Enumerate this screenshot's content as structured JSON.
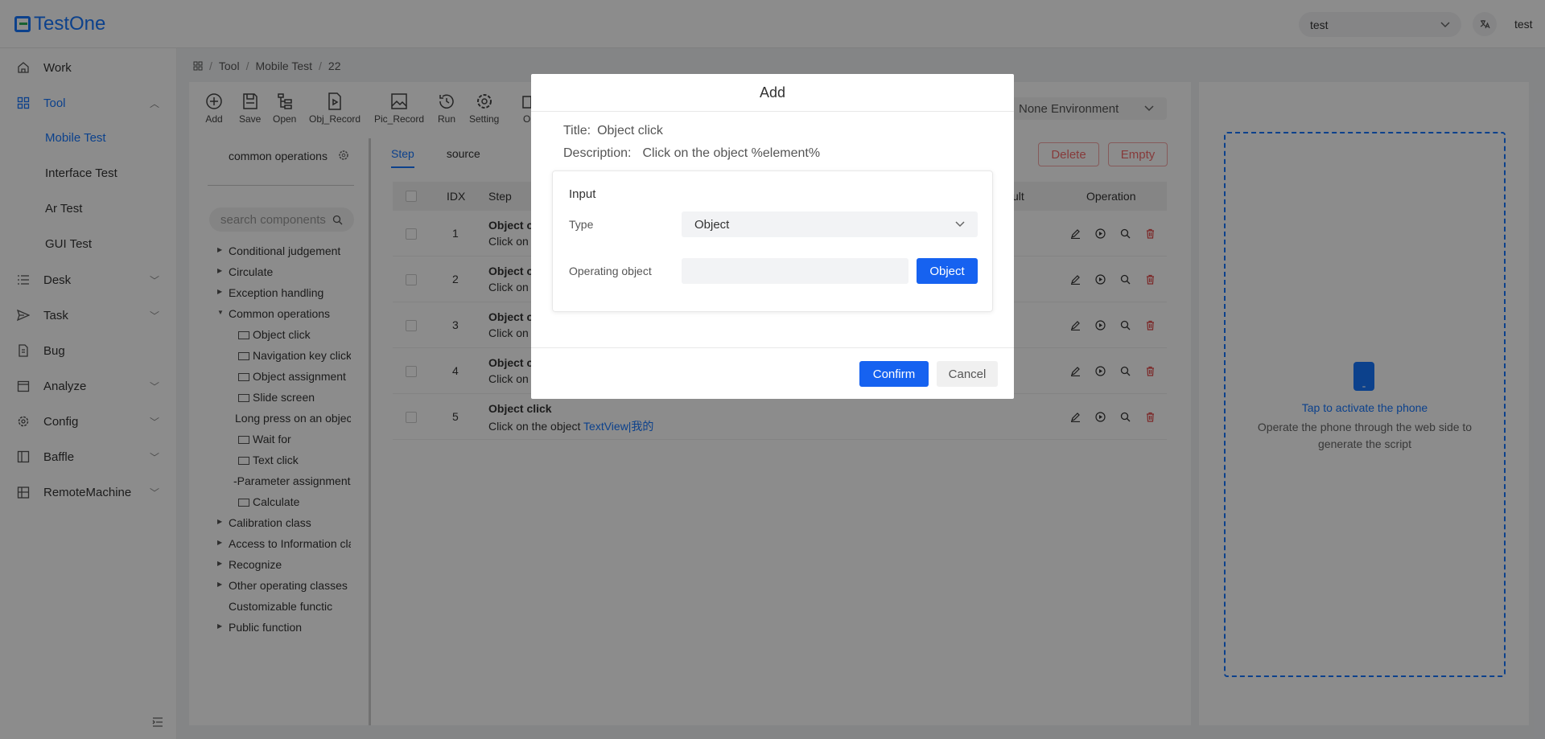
{
  "app": {
    "name": "TestOne"
  },
  "header": {
    "project": "test",
    "user": "test"
  },
  "sidebar": {
    "items": [
      {
        "label": "Work",
        "icon": "home-icon"
      },
      {
        "label": "Tool",
        "icon": "grid-icon"
      },
      {
        "label": "Desk",
        "icon": "list-icon"
      },
      {
        "label": "Task",
        "icon": "send-icon"
      },
      {
        "label": "Bug",
        "icon": "file-icon"
      },
      {
        "label": "Analyze",
        "icon": "calendar-icon"
      },
      {
        "label": "Config",
        "icon": "gear-icon"
      },
      {
        "label": "Baffle",
        "icon": "panel-icon"
      },
      {
        "label": "RemoteMachine",
        "icon": "machine-icon"
      }
    ],
    "tool_sub": [
      "Mobile Test",
      "Interface Test",
      "Ar Test",
      "GUI Test"
    ]
  },
  "breadcrumb": [
    "Tool",
    "Mobile Test",
    "22"
  ],
  "toolbar": {
    "buttons": [
      "Add",
      "Save",
      "Open",
      "Obj_Record",
      "Pic_Record",
      "Run",
      "Setting",
      "Ob"
    ]
  },
  "environment": {
    "value": "None Environment"
  },
  "components": {
    "title": "common operations",
    "search_placeholder": "search components",
    "tree": [
      "Conditional judgement",
      "Circulate",
      "Exception handling",
      "Common operations",
      "Object click",
      "Navigation key click",
      "Object assignment",
      "Slide screen",
      "Long press on an objec",
      "Wait for",
      "Text click",
      "-Parameter assignment",
      "Calculate",
      "Calibration class",
      "Access to Information cla",
      "Recognize",
      "Other operating classes",
      "Customizable functic",
      "Public function"
    ]
  },
  "steps": {
    "tabs": [
      "Step",
      "source"
    ],
    "delete_label": "Delete",
    "empty_label": "Empty",
    "columns": {
      "idx": "IDX",
      "step": "Step",
      "result": "ult",
      "operation": "Operation"
    },
    "rows": [
      {
        "idx": "1",
        "title": "Object c",
        "desc": "Click on"
      },
      {
        "idx": "2",
        "title": "Object c",
        "desc": "Click on"
      },
      {
        "idx": "3",
        "title": "Object c",
        "desc": "Click on"
      },
      {
        "idx": "4",
        "title": "Object c",
        "desc": "Click on"
      },
      {
        "idx": "5",
        "title": "Object click",
        "desc": "Click on the object ",
        "link": "TextView|我的"
      }
    ]
  },
  "phone": {
    "title": "Tap to activate the phone",
    "subtitle": "Operate the phone through the web side to generate the script"
  },
  "modal": {
    "title": "Add",
    "title_label": "Title:",
    "title_value": "Object click",
    "desc_label": "Description:",
    "desc_value": "Click on the object %element%",
    "input_label": "Input",
    "type_label": "Type",
    "type_value": "Object",
    "operating_label": "Operating object",
    "object_button": "Object",
    "confirm": "Confirm",
    "cancel": "Cancel"
  }
}
